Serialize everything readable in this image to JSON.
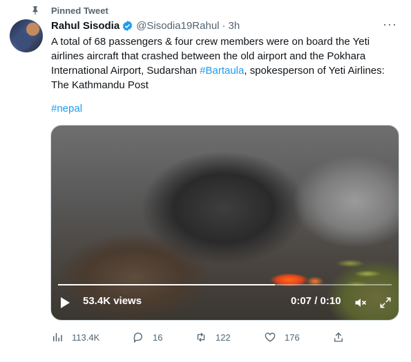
{
  "pinned": {
    "label": "Pinned Tweet",
    "icon": "pin-icon"
  },
  "tweet": {
    "author": {
      "name": "Rahul Sisodia",
      "handle": "@Sisodia19Rahul",
      "separator": "·",
      "time": "3h",
      "verified": true,
      "avatar": "avatar"
    },
    "more_icon": "···",
    "text_part1": "A total of 68 passengers & four crew members were on board the Yeti airlines aircraft that crashed between the old airport and the Pokhara International Airport, Sudarshan ",
    "text_link": "#Bartaula",
    "text_part2": ", spokesperson of Yeti Airlines: The Kathmandu Post",
    "hashtag": "#nepal"
  },
  "video": {
    "views": "53.4K views",
    "timecode": "0:07 / 0:10",
    "progress": 0.65,
    "play_icon": "play-icon",
    "mute_icon": "volume-muted-icon",
    "fullscreen_icon": "fullscreen-icon"
  },
  "actions": {
    "views": "113.4K",
    "replies": "16",
    "retweets": "122",
    "likes": "176"
  },
  "colors": {
    "accent": "#1d9bf0",
    "muted": "#536471",
    "text": "#0f1419"
  }
}
